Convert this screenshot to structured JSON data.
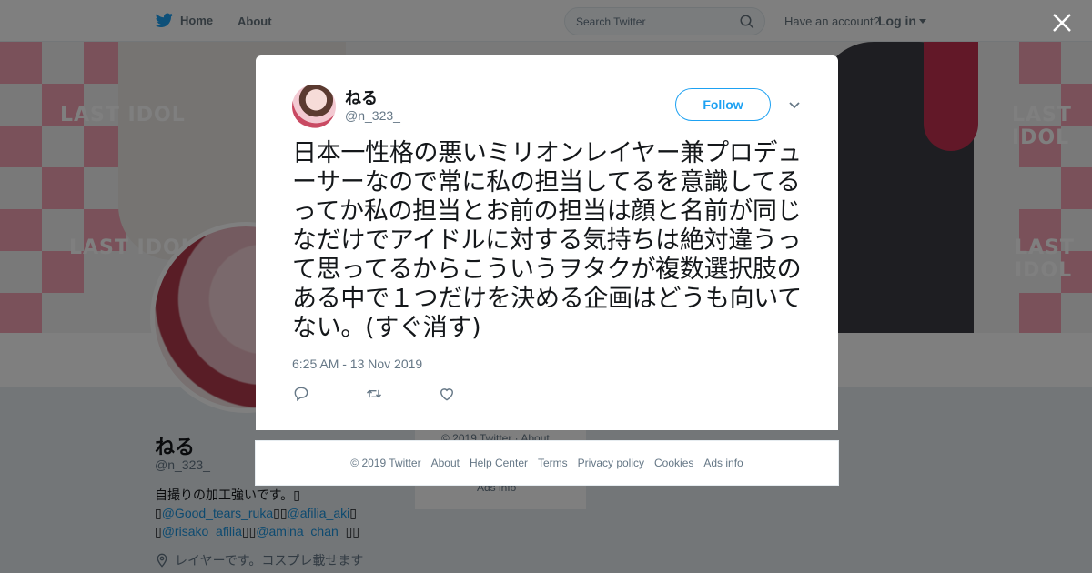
{
  "topbar": {
    "home_label": "Home",
    "about_label": "About",
    "search_placeholder": "Search Twitter",
    "have_account": "Have an account?",
    "login_label": "Log in"
  },
  "banner": {
    "tile_text": "LAST IDOL"
  },
  "profile": {
    "name": "ねる",
    "handle": "@n_323_",
    "bio_line1": "自撮りの加工強いです。",
    "bio_mentions": [
      "@Good_tears_ruka",
      "@afilia_aki",
      "@risako_afilia",
      "@amina_chan_"
    ],
    "location": "レイヤーです。コスプレ載せます"
  },
  "sidebar": {
    "copyright": "© 2019 Twitter",
    "about": "About",
    "ads_info": "Ads info"
  },
  "tweet": {
    "author_name": "ねる",
    "author_handle": "@n_323_",
    "follow_label": "Follow",
    "text": "日本一性格の悪いミリオンレイヤー兼プロデューサーなので常に私の担当してるを意識してるってか私の担当とお前の担当は顔と名前が同じなだけでアイドルに対する気持ちは絶対違うって思ってるからこういうヲタクが複数選択肢のある中で１つだけを決める企画はどうも向いてない。(すぐ消す)",
    "timestamp": "6:25 AM - 13 Nov 2019",
    "icons": {
      "reply": "reply-icon",
      "retweet": "retweet-icon",
      "like": "heart-icon"
    }
  },
  "footer": {
    "links": [
      "© 2019 Twitter",
      "About",
      "Help Center",
      "Terms",
      "Privacy policy",
      "Cookies",
      "Ads info"
    ]
  },
  "colors": {
    "accent": "#1da1f2",
    "secondary_text": "#657786",
    "banner_pink": "#f4a3b4",
    "link": "#1b95e0"
  }
}
